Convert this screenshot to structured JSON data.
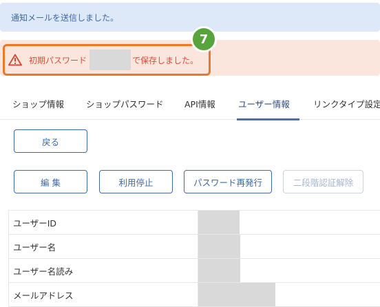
{
  "notice": {
    "message": "通知メールを送信しました。"
  },
  "warning": {
    "icon": "warning-triangle-icon",
    "prefix": "初期パスワード",
    "suffix": "で保存しました。",
    "highlight_color": "#e8782a"
  },
  "annotation": {
    "number": "7",
    "color": "#57a33c"
  },
  "tabs": [
    {
      "label": "ショップ情報",
      "active": false
    },
    {
      "label": "ショップパスワード",
      "active": false
    },
    {
      "label": "API情報",
      "active": false
    },
    {
      "label": "ユーザー情報",
      "active": true
    },
    {
      "label": "リンクタイプ設定",
      "active": false
    }
  ],
  "buttons": {
    "back": "戻る",
    "edit": "編 集",
    "suspend": "利用停止",
    "reissue_password": "パスワード再発行",
    "disable_2fa": "二段階認証解除"
  },
  "table": {
    "rows": [
      {
        "label": "ユーザーID"
      },
      {
        "label": "ユーザー名"
      },
      {
        "label": "ユーザー名読み"
      },
      {
        "label": "メールアドレス"
      }
    ]
  },
  "colors": {
    "primary": "#3f6aa6",
    "warning_text": "#d2503c",
    "warning_bg": "#fbe6dd",
    "info_bg": "#dde8f8"
  }
}
